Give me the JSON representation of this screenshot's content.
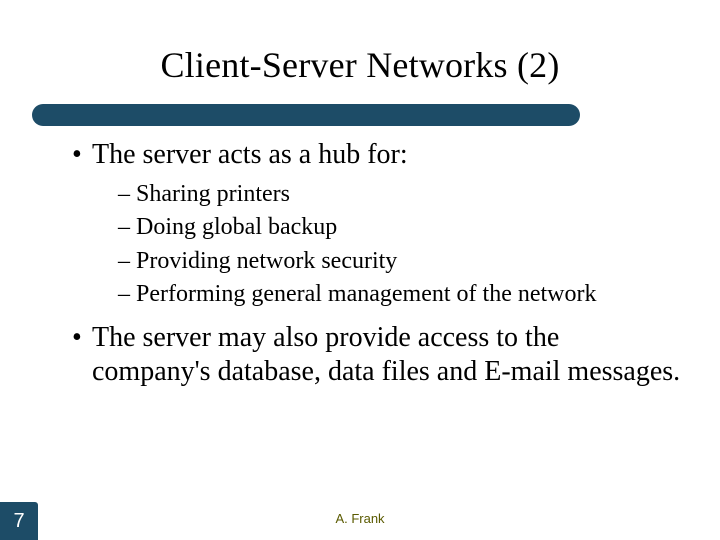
{
  "title": "Client-Server Networks (2)",
  "bullets": [
    {
      "level": 1,
      "text": "The server acts as a hub for:"
    },
    {
      "level": 2,
      "text": "Sharing printers"
    },
    {
      "level": 2,
      "text": "Doing global backup"
    },
    {
      "level": 2,
      "text": "Providing network security"
    },
    {
      "level": 2,
      "text": "Performing general management of the network"
    },
    {
      "level": 1,
      "text": "The server may also provide access to the company's database, data files and E-mail messages."
    }
  ],
  "page_number": "7",
  "footer_author": "A. Frank",
  "glyphs": {
    "bullet": "•",
    "dash": "–"
  }
}
